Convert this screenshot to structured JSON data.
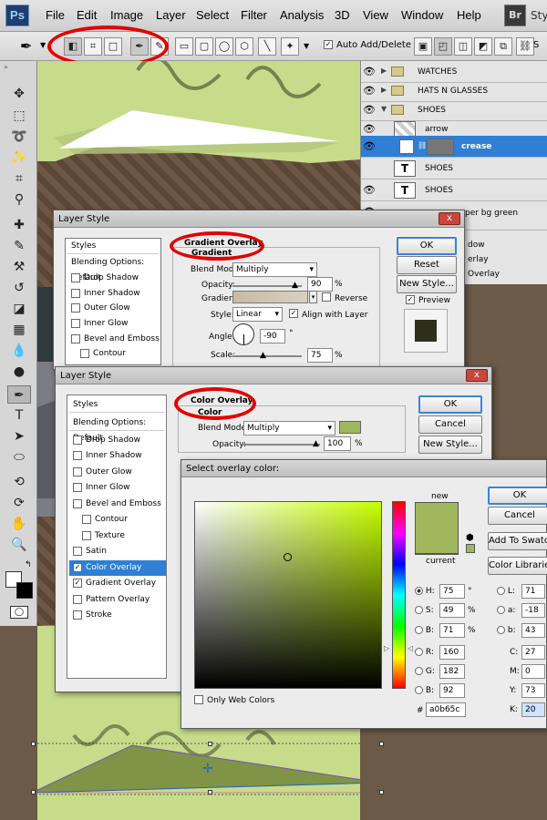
{
  "app": {
    "logo": "Ps",
    "menu": [
      "File",
      "Edit",
      "Image",
      "Layer",
      "Select",
      "Filter",
      "Analysis",
      "3D",
      "View",
      "Window",
      "Help"
    ],
    "bridge_badge": "Br",
    "extra_menu": "Styl"
  },
  "options_bar": {
    "auto_add_delete_label": "Auto Add/Delete",
    "auto_add_delete_checked": true
  },
  "layers_panel": {
    "layers": [
      {
        "name": "WATCHES",
        "kind": "folder"
      },
      {
        "name": "HATS N GLASSES",
        "kind": "folder"
      },
      {
        "name": "SHOES",
        "kind": "folder-open"
      },
      {
        "name": "arrow",
        "kind": "layer"
      },
      {
        "name": "crease",
        "kind": "layer-selected"
      },
      {
        "name": "SHOES",
        "kind": "text",
        "thumb": "T"
      },
      {
        "name": "SHOES",
        "kind": "text",
        "thumb": "T"
      },
      {
        "name": "per bg green",
        "kind": "layer"
      }
    ],
    "effect_rows": [
      "dow",
      "erlay",
      "Overlay"
    ]
  },
  "dialog1": {
    "title": "Layer Style",
    "close": "x",
    "styles_header": "Styles",
    "styles": [
      {
        "label": "Blending Options: Default",
        "checkbox": false
      },
      {
        "label": "Drop Shadow",
        "checkbox": true,
        "checked": false
      },
      {
        "label": "Inner Shadow",
        "checkbox": true,
        "checked": false
      },
      {
        "label": "Outer Glow",
        "checkbox": true,
        "checked": false
      },
      {
        "label": "Inner Glow",
        "checkbox": true,
        "checked": false
      },
      {
        "label": "Bevel and Emboss",
        "checkbox": true,
        "checked": false
      },
      {
        "label": "Contour",
        "checkbox": true,
        "checked": false,
        "indent": true
      }
    ],
    "section_title": "Gradient Overlay",
    "subsection": "Gradient",
    "blend_mode_label": "Blend Mode:",
    "blend_mode": "Multiply",
    "opacity_label": "Opacity:",
    "opacity": "90",
    "percent": "%",
    "gradient_label": "Gradient:",
    "reverse_label": "Reverse",
    "style_label": "Style:",
    "style": "Linear",
    "align_label": "Align with Layer",
    "angle_label": "Angle:",
    "angle": "-90",
    "degree": "°",
    "scale_label": "Scale:",
    "scale": "75",
    "buttons": {
      "ok": "OK",
      "reset": "Reset",
      "new_style": "New Style...",
      "preview": "Preview"
    }
  },
  "dialog2": {
    "title": "Layer Style",
    "close": "x",
    "styles_header": "Styles",
    "styles": [
      {
        "label": "Blending Options: Default",
        "checkbox": false
      },
      {
        "label": "Drop Shadow",
        "checkbox": true,
        "checked": false
      },
      {
        "label": "Inner Shadow",
        "checkbox": true,
        "checked": false
      },
      {
        "label": "Outer Glow",
        "checkbox": true,
        "checked": false
      },
      {
        "label": "Inner Glow",
        "checkbox": true,
        "checked": false
      },
      {
        "label": "Bevel and Emboss",
        "checkbox": true,
        "checked": false
      },
      {
        "label": "Contour",
        "checkbox": true,
        "checked": false,
        "indent": true
      },
      {
        "label": "Texture",
        "checkbox": true,
        "checked": false,
        "indent": true
      },
      {
        "label": "Satin",
        "checkbox": true,
        "checked": false
      },
      {
        "label": "Color Overlay",
        "checkbox": true,
        "checked": true,
        "selected": true
      },
      {
        "label": "Gradient Overlay",
        "checkbox": true,
        "checked": true
      },
      {
        "label": "Pattern Overlay",
        "checkbox": true,
        "checked": false
      },
      {
        "label": "Stroke",
        "checkbox": true,
        "checked": false
      }
    ],
    "section_title": "Color Overlay",
    "subsection": "Color",
    "blend_mode_label": "Blend Mode:",
    "blend_mode": "Multiply",
    "opacity_label": "Opacity:",
    "opacity": "100",
    "percent": "%",
    "buttons": {
      "ok": "OK",
      "cancel": "Cancel",
      "new_style": "New Style..."
    }
  },
  "color_picker": {
    "title": "Select overlay color:",
    "new_label": "new",
    "current_label": "current",
    "color_hex": "#a0b65c",
    "only_web_label": "Only Web Colors",
    "buttons": {
      "ok": "OK",
      "cancel": "Cancel",
      "add_swatch": "Add To Swatches",
      "libraries": "Color Libraries"
    },
    "hsb": [
      {
        "label": "H:",
        "value": "75",
        "unit": "°",
        "on": true
      },
      {
        "label": "S:",
        "value": "49",
        "unit": "%"
      },
      {
        "label": "B:",
        "value": "71",
        "unit": "%"
      }
    ],
    "rgb": [
      {
        "label": "R:",
        "value": "160"
      },
      {
        "label": "G:",
        "value": "182"
      },
      {
        "label": "B:",
        "value": "92"
      }
    ],
    "lab": [
      {
        "label": "L:",
        "value": "71"
      },
      {
        "label": "a:",
        "value": "-18"
      },
      {
        "label": "b:",
        "value": "43"
      }
    ],
    "cmyk": [
      {
        "label": "C:",
        "value": "27",
        "unit": "%"
      },
      {
        "label": "M:",
        "value": "0",
        "unit": "%"
      },
      {
        "label": "Y:",
        "value": "73",
        "unit": "%"
      },
      {
        "label": "K:",
        "value": "20",
        "unit": "%"
      }
    ],
    "hash": "#",
    "hex": "a0b65c"
  },
  "colors": {
    "overlay": "#a0b65c",
    "accent_blue": "#2f7fd5",
    "annotation_red": "#e20000",
    "paper_green": "#c7dc8a"
  }
}
